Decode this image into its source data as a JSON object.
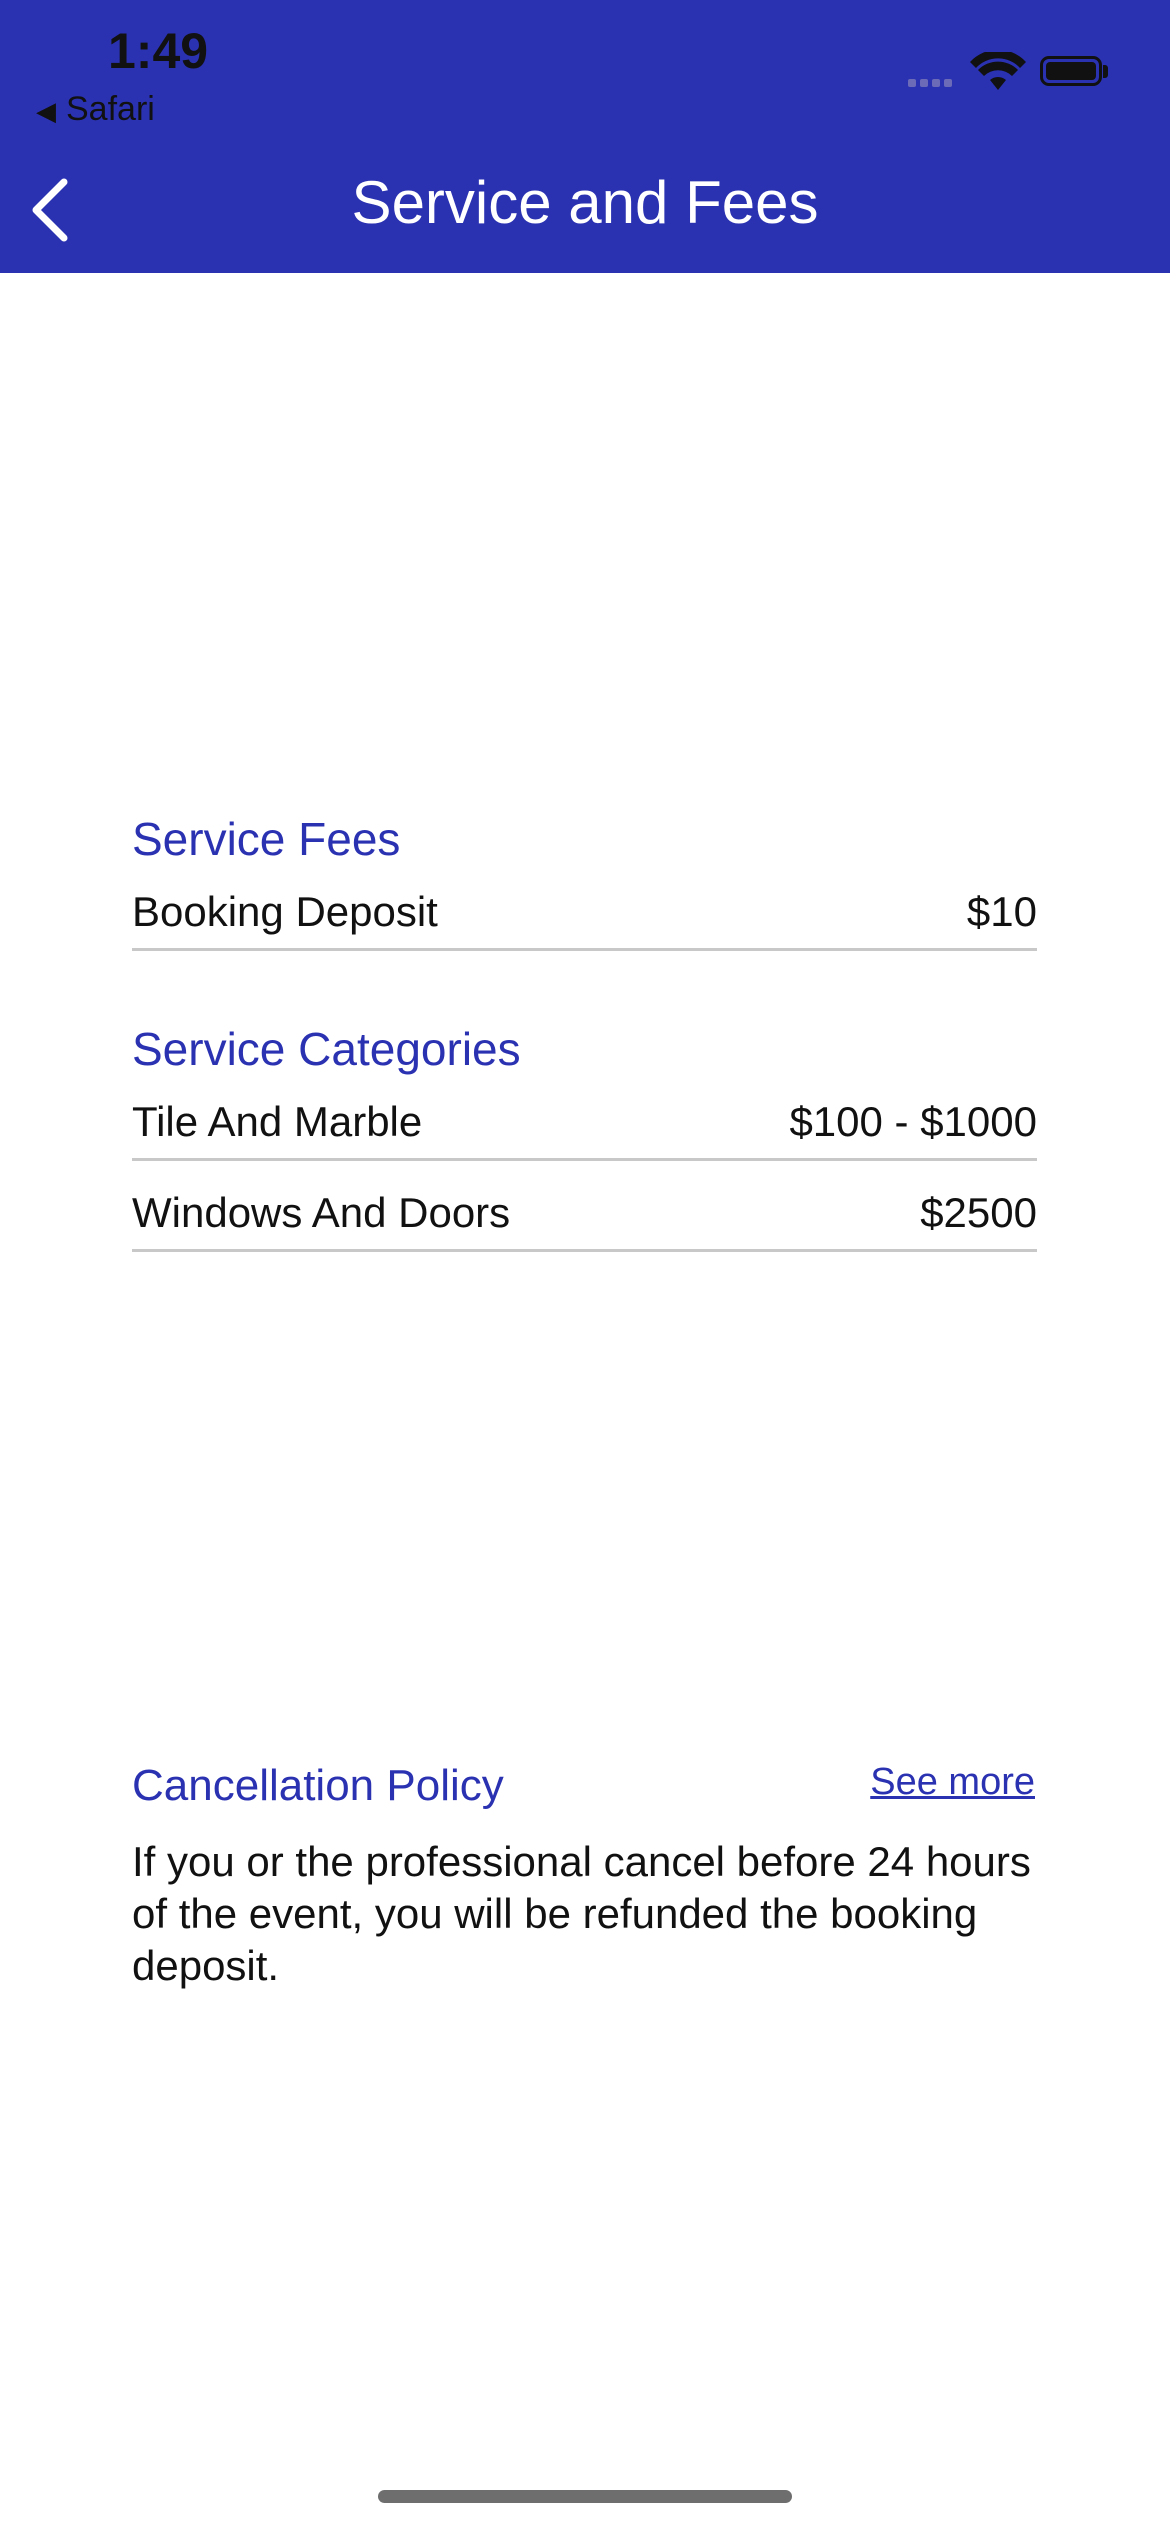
{
  "status_bar": {
    "time": "1:49",
    "back_app": "Safari",
    "icons": [
      "signal-icon",
      "wifi-icon",
      "battery-icon"
    ]
  },
  "header": {
    "title": "Service and Fees",
    "back_icon": "chevron-left-icon",
    "background": "#2b32b2"
  },
  "service_fees": {
    "title": "Service Fees",
    "items": [
      {
        "label": "Booking Deposit",
        "value": "$10"
      }
    ]
  },
  "service_categories": {
    "title": "Service Categories",
    "items": [
      {
        "label": "Tile And Marble",
        "value": "$100 - $1000"
      },
      {
        "label": "Windows And Doors",
        "value": "$2500"
      }
    ]
  },
  "cancellation": {
    "title": "Cancellation Policy",
    "see_more": "See more",
    "text": "If you or the professional cancel before 24 hours of the event, you will be refunded the booking deposit."
  },
  "colors": {
    "accent": "#2b32b2",
    "divider": "#c8c8c8"
  }
}
